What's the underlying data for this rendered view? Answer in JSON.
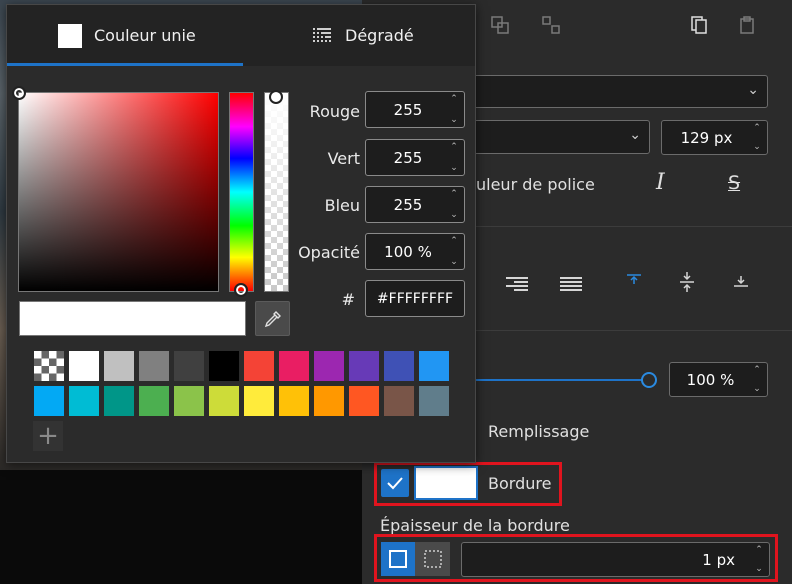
{
  "colors": {
    "accent": "#1e73c8",
    "highlight": "#e0141e",
    "current": "#FFFFFF"
  },
  "popup": {
    "tabs": [
      {
        "label": "Couleur unie",
        "icon": "square-swatch-icon"
      },
      {
        "label": "Dégradé",
        "icon": "gradient-grid-icon"
      }
    ],
    "fields": {
      "red": {
        "label": "Rouge",
        "value": "255"
      },
      "green": {
        "label": "Vert",
        "value": "255"
      },
      "blue": {
        "label": "Bleu",
        "value": "255"
      },
      "opacity": {
        "label": "Opacité",
        "value": "100 %"
      },
      "hex": {
        "label": "#",
        "value": "#FFFFFFFF"
      }
    },
    "swatches": [
      "transparent",
      "#FFFFFF",
      "#C0C0C0",
      "#808080",
      "#404040",
      "#000000",
      "#F44336",
      "#E91E63",
      "#9C27B0",
      "#673AB7",
      "#3F51B5",
      "#2196F3",
      "#03A9F4",
      "#00BCD4",
      "#009688",
      "#4CAF50",
      "#8BC34A",
      "#CDDC39",
      "#FFEB3B",
      "#FFC107",
      "#FF9800",
      "#FF5722",
      "#795548",
      "#607D8B"
    ]
  },
  "panel": {
    "font_size": "129 px",
    "font_color_label": "uleur de police",
    "opacity_value": "100 %",
    "fill_label": "Remplissage",
    "border_label": "Bordure",
    "border_width_label": "Épaisseur de la bordure",
    "border_width_value": "1 px",
    "italic_glyph": "I",
    "strike_glyph": "S"
  }
}
